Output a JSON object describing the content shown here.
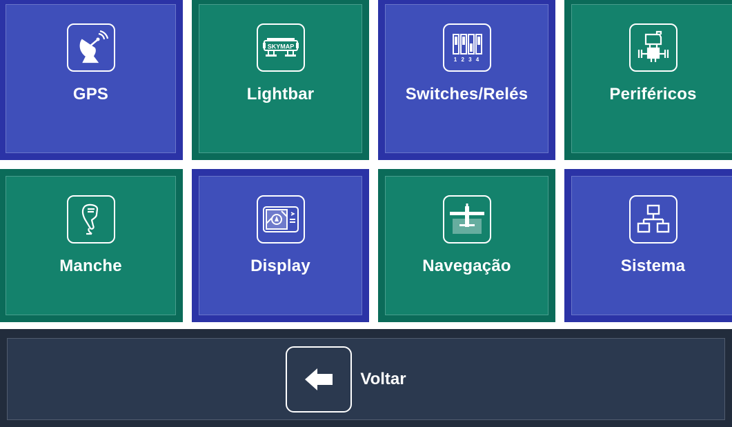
{
  "menu": {
    "tiles": [
      {
        "label": "GPS",
        "icon": "satellite-dish-icon",
        "color": "blue"
      },
      {
        "label": "Lightbar",
        "icon": "skymap-lightbar-icon",
        "color": "green",
        "icon_text": "SKYMAP"
      },
      {
        "label": "Switches/Relés",
        "icon": "dip-switches-icon",
        "color": "blue",
        "icon_text": "1 2 3 4"
      },
      {
        "label": "Periféricos",
        "icon": "valve-peripheral-icon",
        "color": "green"
      },
      {
        "label": "Manche",
        "icon": "joystick-icon",
        "color": "green"
      },
      {
        "label": "Display",
        "icon": "display-screen-icon",
        "color": "blue"
      },
      {
        "label": "Navegação",
        "icon": "airplane-navigation-icon",
        "color": "green"
      },
      {
        "label": "Sistema",
        "icon": "system-network-icon",
        "color": "blue"
      }
    ]
  },
  "back": {
    "label": "Voltar",
    "icon": "arrow-left-icon"
  },
  "colors": {
    "blue_outer": "#2b33a6",
    "blue_inner": "#3f4fba",
    "green_outer": "#0b6b59",
    "green_inner": "#14826c",
    "back_outer": "#222c3c",
    "back_inner": "#2b394f"
  }
}
